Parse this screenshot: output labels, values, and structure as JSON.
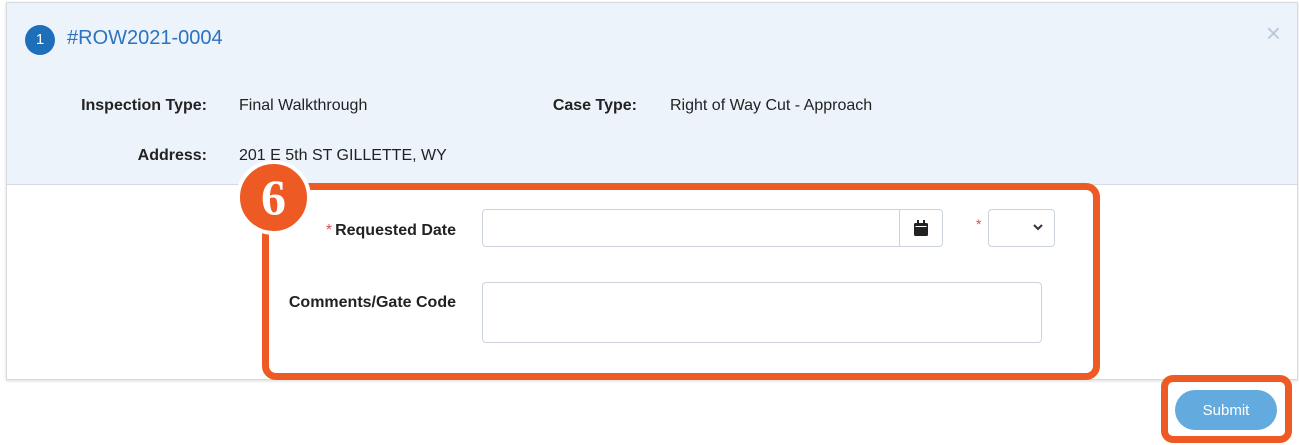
{
  "header": {
    "step_number": "1",
    "case_number": "#ROW2021-0004",
    "close_symbol": "×"
  },
  "details": {
    "inspection_type_label": "Inspection Type:",
    "inspection_type_value": "Final Walkthrough",
    "case_type_label": "Case Type:",
    "case_type_value": "Right of Way Cut - Approach",
    "address_label": "Address:",
    "address_value": "201 E 5th ST GILLETTE, WY"
  },
  "form": {
    "required_marker": "*",
    "requested_date_label": "Requested Date",
    "requested_date_value": "",
    "time_select_value": "",
    "comments_label": "Comments/Gate Code",
    "comments_value": ""
  },
  "annotation": {
    "step_badge": "6",
    "accent_color": "#ee5a24"
  },
  "actions": {
    "submit_label": "Submit"
  },
  "icons": {
    "calendar": "calendar-icon",
    "chevron": "chevron-down-icon",
    "close": "close-icon"
  }
}
